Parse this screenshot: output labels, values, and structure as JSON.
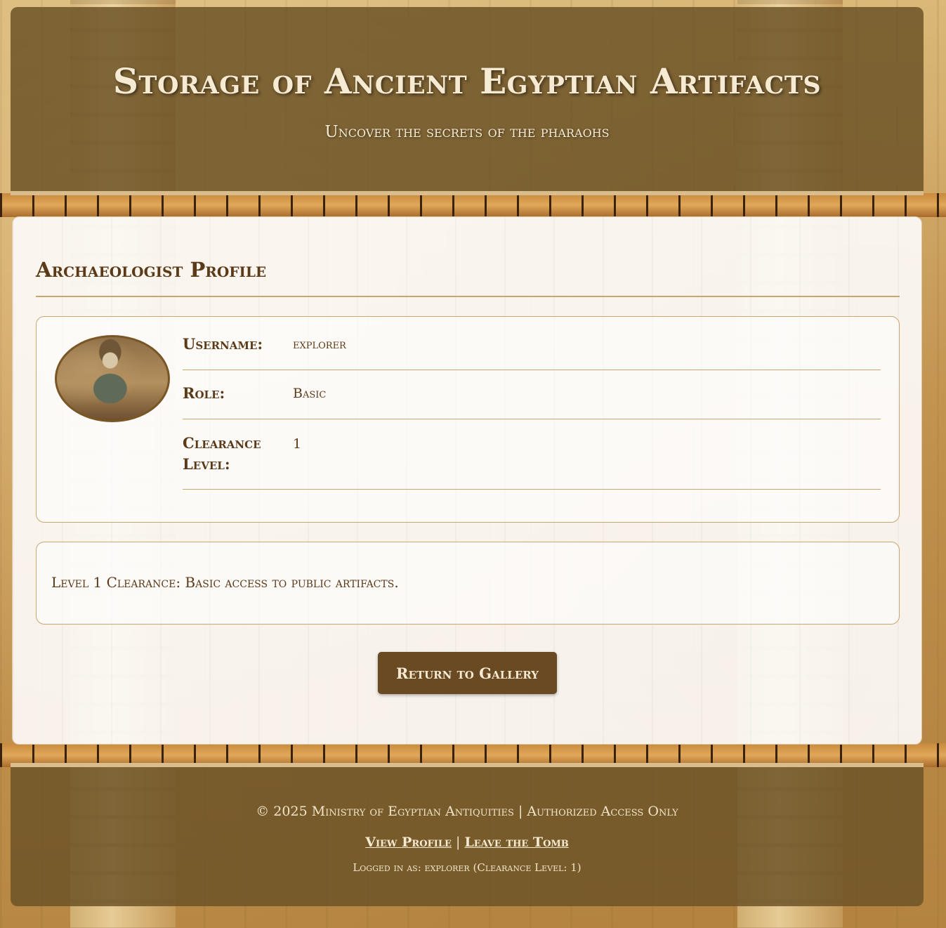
{
  "header": {
    "title": "Storage of Ancient Egyptian Artifacts",
    "subtitle": "Uncover the secrets of the pharaohs"
  },
  "profile": {
    "heading": "Archaeologist Profile",
    "avatar_icon": "archaeologist-photo",
    "fields": [
      {
        "label": "Username:",
        "value": "explorer"
      },
      {
        "label": "Role:",
        "value": "Basic"
      },
      {
        "label": "Clearance Level:",
        "value": "1"
      }
    ],
    "clearance_note": "Level 1 Clearance: Basic access to public artifacts.",
    "return_button": "Return to Gallery"
  },
  "footer": {
    "copyright": "© 2025 Ministry of Egyptian Antiquities | Authorized Access Only",
    "links": [
      "View Profile",
      "Leave the Tomb"
    ],
    "separator": "|",
    "status": "Logged in as: explorer (Clearance Level: 1)"
  },
  "colors": {
    "header_bg": "#6e5428",
    "button_bg": "#6a4a22",
    "text_brown": "#5b3a18",
    "rule_gold": "#c9a570"
  }
}
